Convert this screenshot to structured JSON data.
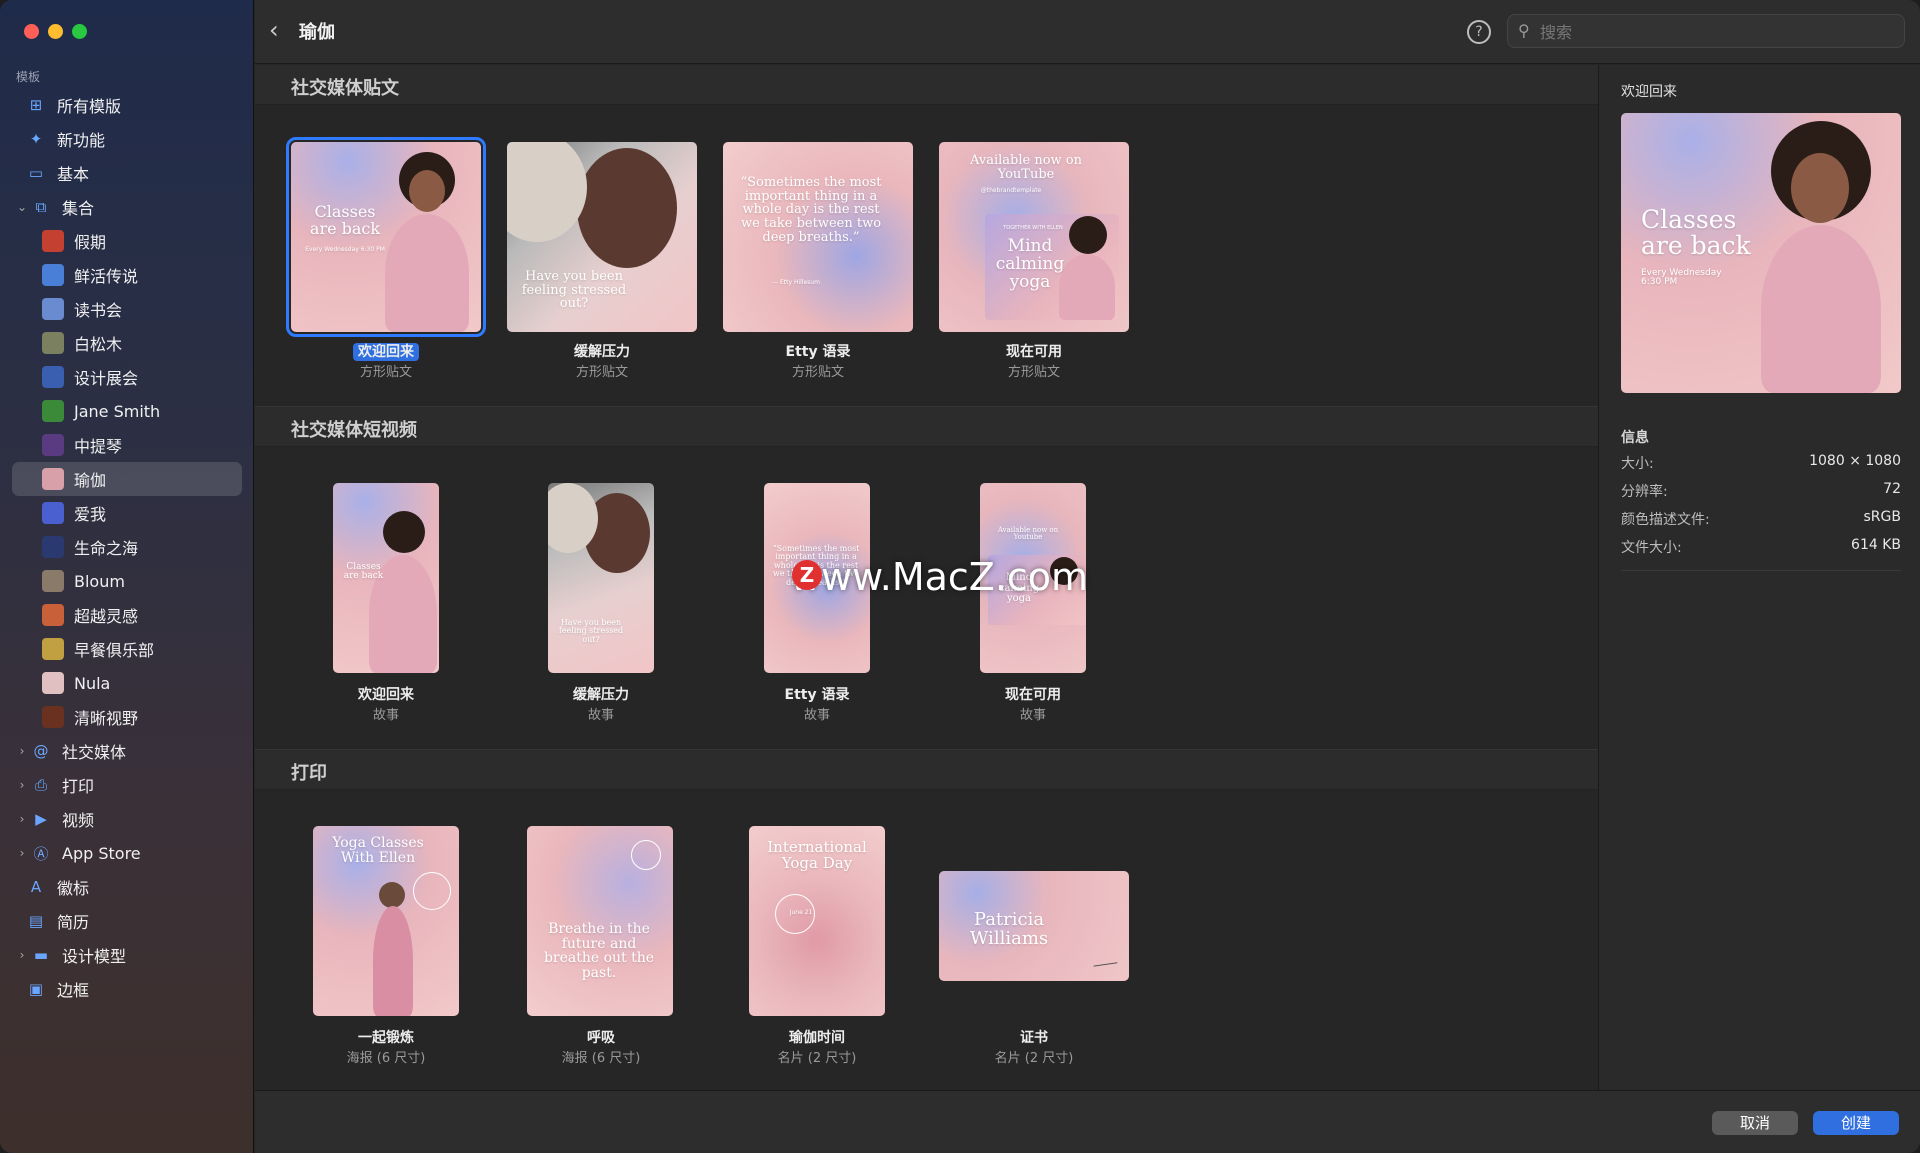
{
  "sidebar": {
    "section_label": "模板",
    "items": [
      {
        "label": "所有模版",
        "icon": "grid-icon",
        "kind": "top"
      },
      {
        "label": "新功能",
        "icon": "sparkle-icon",
        "kind": "top"
      },
      {
        "label": "基本",
        "icon": "browser-window-icon",
        "kind": "top"
      },
      {
        "label": "集合",
        "icon": "collection-icon",
        "kind": "expanded"
      },
      {
        "label": "假期",
        "thumb": "#c44030",
        "kind": "child"
      },
      {
        "label": "鲜活传说",
        "thumb": "#4a7fd8",
        "kind": "child"
      },
      {
        "label": "读书会",
        "thumb": "#6a8bd0",
        "kind": "child"
      },
      {
        "label": "白松木",
        "thumb": "#7a8060",
        "kind": "child"
      },
      {
        "label": "设计展会",
        "thumb": "#3a5fb0",
        "kind": "child"
      },
      {
        "label": "Jane Smith",
        "thumb": "#3a8a3a",
        "kind": "child"
      },
      {
        "label": "中提琴",
        "thumb": "#5a3a80",
        "kind": "child"
      },
      {
        "label": "瑜伽",
        "thumb": "#d8a0a8",
        "kind": "child",
        "selected": true
      },
      {
        "label": "爱我",
        "thumb": "#4a60d0",
        "kind": "child"
      },
      {
        "label": "生命之海",
        "thumb": "#2a3a70",
        "kind": "child"
      },
      {
        "label": "Bloum",
        "thumb": "#8a7a6a",
        "kind": "child"
      },
      {
        "label": "超越灵感",
        "thumb": "#c8603a",
        "kind": "child"
      },
      {
        "label": "早餐俱乐部",
        "thumb": "#c0a040",
        "kind": "child"
      },
      {
        "label": "Nula",
        "thumb": "#e0c0c0",
        "kind": "child"
      },
      {
        "label": "清晰视野",
        "thumb": "#6a3020",
        "kind": "child"
      },
      {
        "label": "社交媒体",
        "icon": "at-sign-icon",
        "kind": "collapsed"
      },
      {
        "label": "打印",
        "icon": "printer-icon",
        "kind": "collapsed"
      },
      {
        "label": "视频",
        "icon": "play-icon",
        "kind": "collapsed"
      },
      {
        "label": "App Store",
        "icon": "app-store-icon",
        "kind": "collapsed"
      },
      {
        "label": "徽标",
        "icon": "letter-a-icon",
        "kind": "top"
      },
      {
        "label": "简历",
        "icon": "document-icon",
        "kind": "top"
      },
      {
        "label": "设计模型",
        "icon": "display-icon",
        "kind": "collapsed"
      },
      {
        "label": "边框",
        "icon": "photo-frame-icon",
        "kind": "top"
      }
    ]
  },
  "header": {
    "title": "瑜伽",
    "help": "?",
    "search_placeholder": "搜索"
  },
  "sections": [
    {
      "title": "社交媒体贴文",
      "cards": [
        {
          "label": "欢迎回来",
          "sub": "方形贴文",
          "selected": true,
          "thumb_text": "Classes are back",
          "thumb_small": "Every Wednesday 6:30 PM"
        },
        {
          "label": "缓解压力",
          "sub": "方形贴文",
          "thumb_text": "Have you been feeling stressed out?"
        },
        {
          "label": "Etty 语录",
          "sub": "方形贴文",
          "thumb_text": "“Sometimes the most important thing in a whole day is the rest we take between two deep breaths.”",
          "thumb_small": "— Etty Hillesum"
        },
        {
          "label": "现在可用",
          "sub": "方形贴文",
          "thumb_text": "Available now on YouTube",
          "thumb_small": "@thebrandtemplate",
          "thumb_text2": "Mind calming yoga",
          "thumb_small2": "TOGETHER WITH ELLEN"
        }
      ]
    },
    {
      "title": "社交媒体短视频",
      "cards": [
        {
          "label": "欢迎回来",
          "sub": "故事",
          "thumb_text": "Classes are back"
        },
        {
          "label": "缓解压力",
          "sub": "故事",
          "thumb_text": "Have you been feeling stressed out?"
        },
        {
          "label": "Etty 语录",
          "sub": "故事",
          "thumb_text": "“Sometimes the most important thing in a whole day is the rest we take between two deep breaths.”"
        },
        {
          "label": "现在可用",
          "sub": "故事",
          "thumb_text": "Available now on Youtube",
          "thumb_text2": "Mind calming yoga"
        }
      ]
    },
    {
      "title": "打印",
      "cards": [
        {
          "label": "一起锻炼",
          "sub": "海报 (6 尺寸)",
          "thumb_text": "Yoga Classes With Ellen"
        },
        {
          "label": "呼吸",
          "sub": "海报 (6 尺寸)",
          "thumb_text": "Breathe in the future and breathe out the past."
        },
        {
          "label": "瑜伽时间",
          "sub": "名片 (2 尺寸)",
          "thumb_text": "International Yoga Day",
          "thumb_small": "June 21"
        },
        {
          "label": "证书",
          "sub": "名片 (2 尺寸)",
          "thumb_text": "Patricia Williams"
        }
      ]
    }
  ],
  "inspector": {
    "title": "欢迎回来",
    "preview_text": "Classes are back",
    "preview_small": "Every Wednesday 6:30 PM",
    "info_title": "信息",
    "rows": [
      {
        "k": "大小:",
        "v": "1080 × 1080"
      },
      {
        "k": "分辨率:",
        "v": "72"
      },
      {
        "k": "颜色描述文件:",
        "v": "sRGB"
      },
      {
        "k": "文件大小:",
        "v": "614 KB"
      }
    ]
  },
  "footer": {
    "cancel": "取消",
    "create": "创建"
  },
  "watermark": {
    "badge": "Z",
    "text": "www.MacZ.com"
  },
  "colors": {
    "accent": "#2f6fe0",
    "pink": "#e9b7bc",
    "blue_glow": "#9aa8e6"
  }
}
